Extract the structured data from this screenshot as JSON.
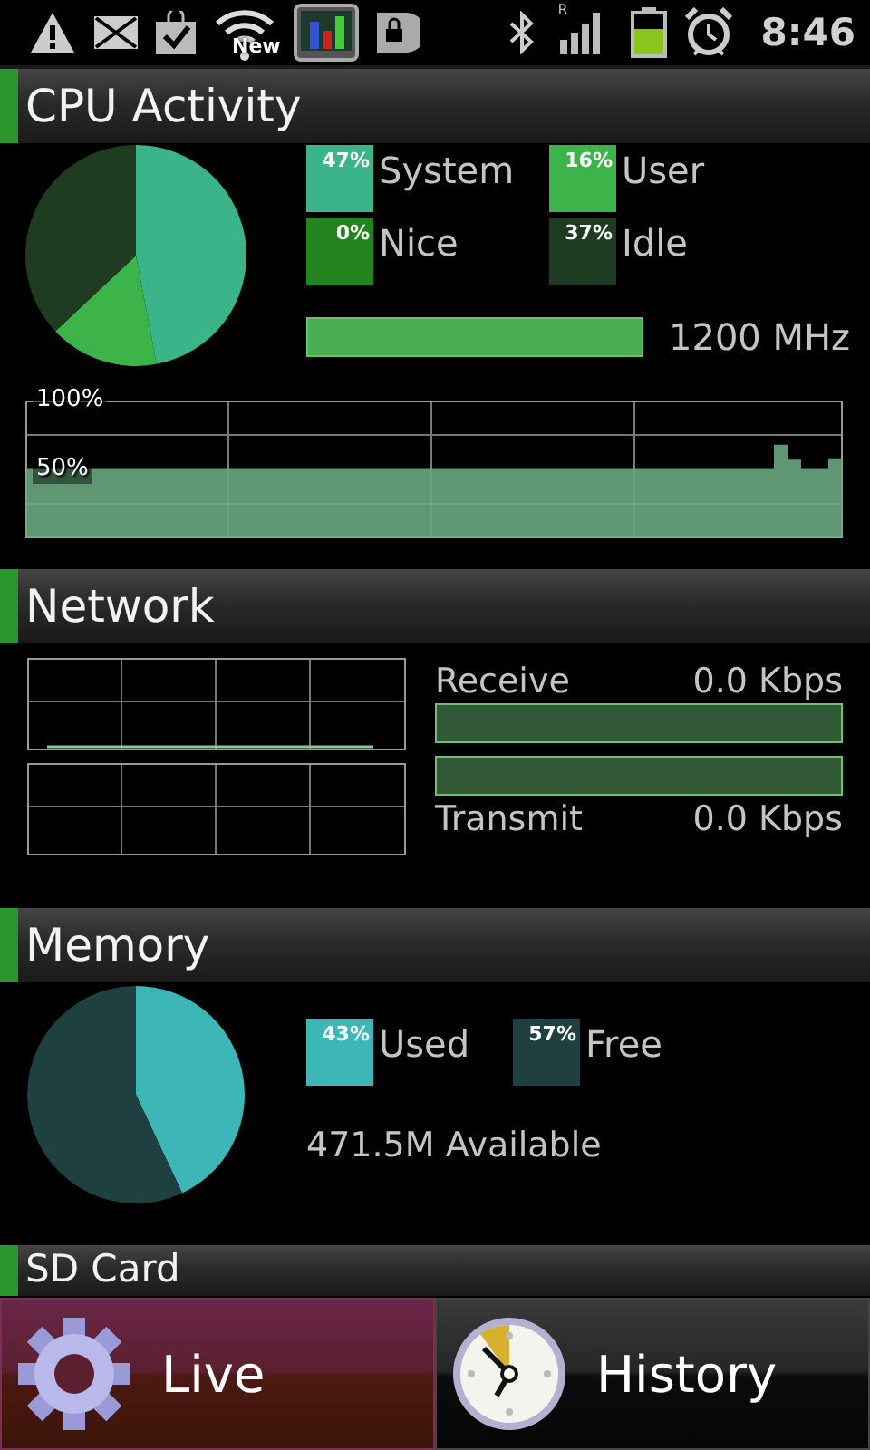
{
  "status_bar": {
    "wifi_badge": "New",
    "signal_badge": "R",
    "time": "8:46"
  },
  "cpu": {
    "title": "CPU Activity",
    "chart_data": {
      "type": "pie",
      "categories": [
        "System",
        "User",
        "Nice",
        "Idle"
      ],
      "series": [
        {
          "values": [
            47,
            16,
            0,
            37
          ]
        }
      ]
    },
    "legend": [
      {
        "value": "47%",
        "color": "#3cb48a"
      },
      {
        "value": "16%",
        "color": "#3cb44a"
      },
      {
        "value": "0%",
        "color": "#23841f"
      },
      {
        "value": "37%",
        "color": "#1f3b22"
      }
    ],
    "frequency": {
      "reading": "1200 MHz"
    },
    "history": {
      "chart_data": {
        "type": "area",
        "ylim": [
          0,
          100
        ],
        "yticks": [
          {
            "value": 50,
            "label": "50%"
          },
          {
            "value": 100,
            "label": "100%"
          }
        ],
        "series": [
          {
            "color": "#6aa780",
            "values": [
              51,
              51,
              51,
              51,
              51,
              51,
              51,
              51,
              51,
              51,
              51,
              51,
              51,
              51,
              51,
              51,
              51,
              51,
              51,
              51,
              51,
              51,
              51,
              51,
              51,
              51,
              51,
              51,
              51,
              51,
              51,
              51,
              51,
              51,
              51,
              51,
              51,
              51,
              51,
              51,
              51,
              51,
              51,
              51,
              51,
              51,
              51,
              51,
              51,
              51,
              51,
              51,
              51,
              51,
              51,
              68,
              57,
              51,
              51,
              58
            ]
          }
        ]
      }
    }
  },
  "network": {
    "title": "Network",
    "receive": {
      "label": "Receive",
      "reading": "0.0 Kbps",
      "level": 0
    },
    "transmit": {
      "label": "Transmit",
      "reading": "0.0 Kbps",
      "level": 0
    }
  },
  "memory": {
    "title": "Memory",
    "chart_data": {
      "type": "pie",
      "categories": [
        "Used",
        "Free"
      ],
      "series": [
        {
          "values": [
            43,
            57
          ]
        }
      ]
    },
    "legend": [
      {
        "value": "43%",
        "color": "#3cb6b6"
      },
      {
        "value": "57%",
        "color": "#1e4040"
      }
    ],
    "available": "471.5M Available"
  },
  "sd_card": {
    "title": "SD Card"
  },
  "tabs": [
    {
      "label": "Live",
      "selected": true
    },
    {
      "label": "History",
      "selected": false
    }
  ]
}
